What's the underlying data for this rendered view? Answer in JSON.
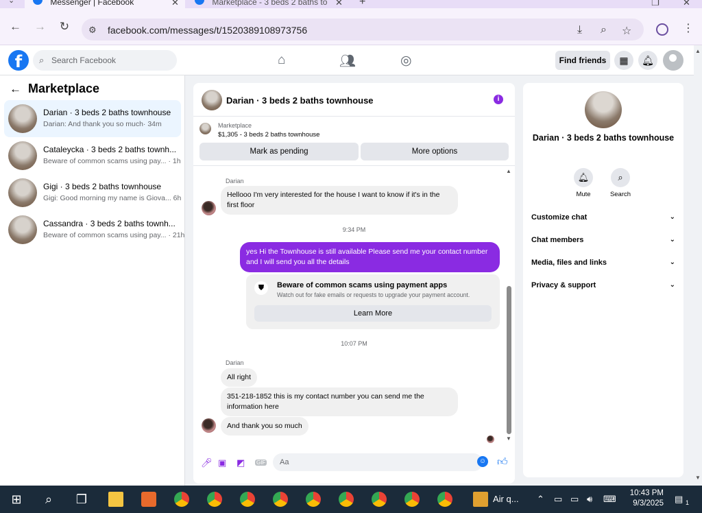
{
  "browser": {
    "tabs": [
      {
        "label": "Messenger | Facebook"
      },
      {
        "label": "Marketplace - 3 beds 2 baths to"
      }
    ],
    "url": "facebook.com/messages/t/1520389108973756"
  },
  "fb": {
    "logo": "f",
    "search_placeholder": "Search Facebook",
    "find_friends": "Find friends"
  },
  "sidebar": {
    "title": "Marketplace",
    "conversations": [
      {
        "name": "Darian · 3 beds 2 baths townhouse",
        "snippet": "Darian: And thank you so much",
        "time": "· 34m"
      },
      {
        "name": "Cataleycka · 3 beds 2 baths townh...",
        "snippet": "Beware of common scams using pay...",
        "time": "· 1h"
      },
      {
        "name": "Gigi · 3 beds 2 baths townhouse",
        "snippet": "Gigi: Good morning my name is Giova...",
        "time": "6h"
      },
      {
        "name": "Cassandra · 3 beds 2 baths townh...",
        "snippet": "Beware of common scams using pay...",
        "time": "· 21h"
      }
    ]
  },
  "chat": {
    "title": "Darian · 3 beds 2 baths townhouse",
    "info_glyph": "i",
    "marketplace_label": "Marketplace",
    "listing": "$1,305 - 3 beds 2 baths townhouse",
    "mark_pending": "Mark as pending",
    "more_options": "More options",
    "messages": {
      "sender1": "Darian",
      "m1": "Hellooo I'm very interested for the house I want to know if it's in the first floor",
      "time1": "9:34 PM",
      "out1": "yes Hi the Townhouse is still available Please send me your contact number and I will send you all the details",
      "scam_title": "Beware of common scams using payment apps",
      "scam_sub": "Watch out for fake emails or requests to upgrade your payment account.",
      "learn_more": "Learn More",
      "time2": "10:07 PM",
      "sender2": "Darian",
      "m2": "All right",
      "m3": "351-218-1852 this is my contact number you can send me the information here",
      "m4": "And thank you so much"
    },
    "composer_placeholder": "Aa",
    "gif_label": "GIF"
  },
  "details": {
    "name": "Darian · 3 beds 2 baths townhouse",
    "mute": "Mute",
    "search": "Search",
    "sections": [
      "Customize chat",
      "Chat members",
      "Media, files and links",
      "Privacy & support"
    ]
  },
  "taskbar": {
    "app_label": "Air q...",
    "time": "10:43 PM",
    "date": "9/3/2025",
    "notif_count": "1"
  },
  "colors": {
    "brand": "#1877f2",
    "accent": "#8a2be2"
  },
  "icons": {
    "back": "arrow-left-icon",
    "shield": "shield-icon",
    "bell": "bell-icon",
    "search": "search-icon"
  }
}
